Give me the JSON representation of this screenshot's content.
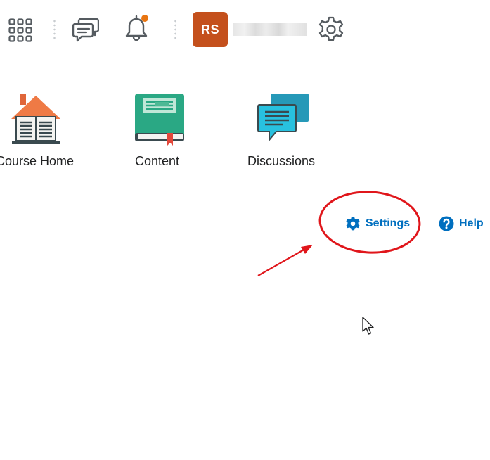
{
  "header": {
    "avatar_initials": "RS"
  },
  "nav": {
    "items": [
      {
        "label": "Course Home"
      },
      {
        "label": "Content"
      },
      {
        "label": "Discussions"
      }
    ]
  },
  "links": {
    "settings_label": "Settings",
    "help_label": "Help"
  },
  "colors": {
    "accent": "#006fbf",
    "avatar_bg": "#c4501c",
    "notification_dot": "#e87511",
    "annotation_red": "#e0161b"
  },
  "icons": [
    "apps-grid-icon",
    "chat-icon",
    "bell-icon",
    "gear-icon",
    "house-book-icon",
    "book-icon",
    "discussions-icon",
    "settings-gear-icon",
    "help-icon",
    "mouse-cursor-icon"
  ]
}
